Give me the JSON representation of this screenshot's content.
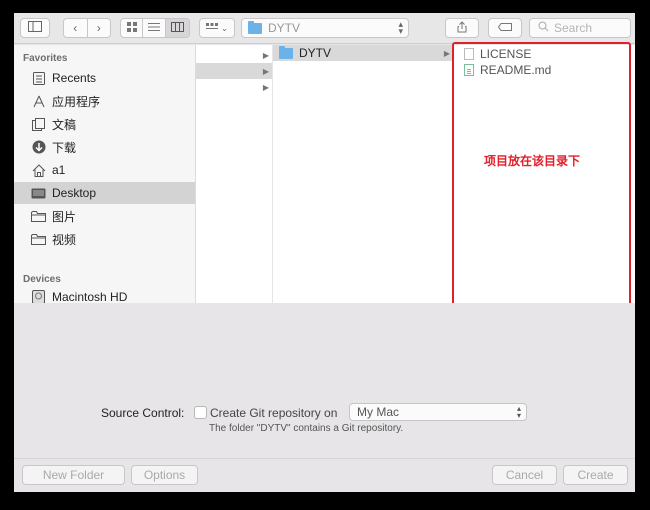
{
  "toolbar": {
    "sidebar_toggle_icon": "sidebar-icon",
    "back_icon": "chevron-left-icon",
    "forward_icon": "chevron-right-icon",
    "view_modes": [
      "icon-view-icon",
      "list-view-icon",
      "column-view-icon"
    ],
    "active_view": "column-view-icon",
    "arrange_icon": "arrange-grid-icon",
    "path": "DYTV",
    "share_icon": "share-icon",
    "tag_icon": "tag-icon",
    "search_placeholder": "Search"
  },
  "sidebar": {
    "favorites_header": "Favorites",
    "favorites": [
      {
        "label": "Recents",
        "icon": "recents-icon"
      },
      {
        "label": "应用程序",
        "icon": "applications-icon"
      },
      {
        "label": "文稿",
        "icon": "documents-icon"
      },
      {
        "label": "下载",
        "icon": "downloads-icon"
      },
      {
        "label": "a1",
        "icon": "home-icon"
      },
      {
        "label": "Desktop",
        "icon": "desktop-icon",
        "selected": true
      },
      {
        "label": "图片",
        "icon": "folder-icon"
      },
      {
        "label": "视频",
        "icon": "folder-icon"
      }
    ],
    "devices_header": "Devices",
    "devices": [
      {
        "label": "Macintosh HD",
        "icon": "harddisk-icon"
      }
    ]
  },
  "columns": {
    "col2": [
      {
        "label": "DYTV",
        "selected": true
      }
    ],
    "col3": [
      {
        "label": "LICENSE",
        "icon": "document-icon"
      },
      {
        "label": "README.md",
        "icon": "markdown-file-icon"
      }
    ]
  },
  "annotation": {
    "text": "项目放在该目录下",
    "color": "#e0202a"
  },
  "options": {
    "source_control_label": "Source Control:",
    "checkbox_label": "Create Git repository on",
    "checkbox_checked": false,
    "location_value": "My Mac",
    "note": "The folder \"DYTV\" contains a Git repository."
  },
  "footer": {
    "new_folder": "New Folder",
    "options": "Options",
    "cancel": "Cancel",
    "create": "Create"
  }
}
